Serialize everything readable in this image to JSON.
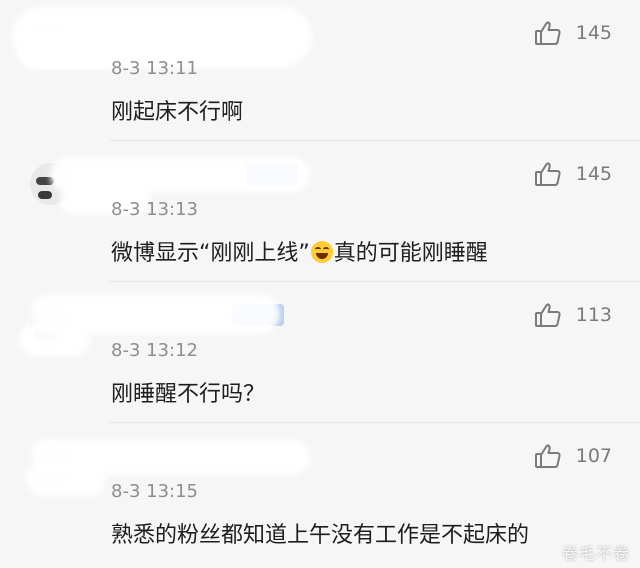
{
  "comments": [
    {
      "timestamp": "8-3 13:11",
      "text": "刚起床不行啊",
      "likes": "145"
    },
    {
      "timestamp": "8-3 13:13",
      "text_before": "微博显示“刚刚上线”",
      "text_after": "真的可能刚睡醒",
      "likes": "145"
    },
    {
      "timestamp": "8-3 13:12",
      "text": "刚睡醒不行吗？",
      "likes": "113"
    },
    {
      "timestamp": "8-3 13:15",
      "text": "熟悉的粉丝都知道上午没有工作是不起床的",
      "likes": "107"
    }
  ],
  "icons": {
    "like": "thumbs-up-icon",
    "reaction": "laughing-tears-emoji"
  },
  "colors": {
    "background": "#f6f6f6",
    "text": "#1e1e1e",
    "meta": "#8e8e8e"
  },
  "watermark": "卷毛不卷"
}
